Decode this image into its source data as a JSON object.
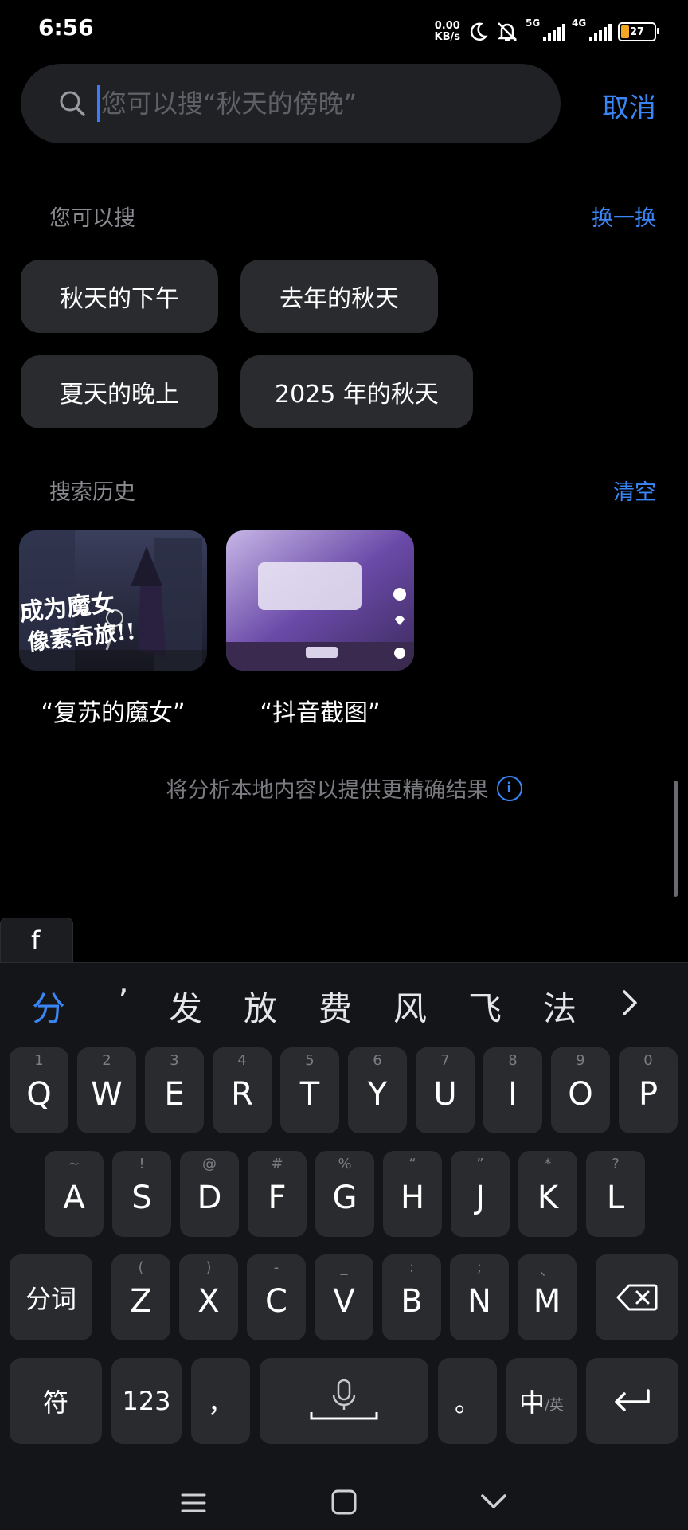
{
  "status": {
    "time": "6:56",
    "speed_top": "0.00",
    "speed_bottom": "KB/s",
    "net1": "5G",
    "net2": "4G",
    "battery": "27"
  },
  "search": {
    "placeholder": "您可以搜“秋天的傍晚”",
    "cancel": "取消"
  },
  "suggest": {
    "title": "您可以搜",
    "action": "换一换",
    "chips": [
      "秋天的下午",
      "去年的秋天",
      "夏天的晚上",
      "2025 年的秋天"
    ]
  },
  "history": {
    "title": "搜索历史",
    "action": "清空",
    "items": [
      {
        "caption": "“复苏的魔女”",
        "overlay_line1": "成为魔女",
        "overlay_line2": "像素奇旅!!"
      },
      {
        "caption": "“抖音截图”"
      }
    ]
  },
  "note": {
    "text": "将分析本地内容以提供更精确结果",
    "icon": "info-icon"
  },
  "keyboard": {
    "composing": "f",
    "candidates": [
      "分",
      "’",
      "发",
      "放",
      "费",
      "风",
      "飞",
      "法"
    ],
    "more_icon": "chevron-right-icon",
    "row1": [
      {
        "k": "Q",
        "h": "1"
      },
      {
        "k": "W",
        "h": "2"
      },
      {
        "k": "E",
        "h": "3"
      },
      {
        "k": "R",
        "h": "4"
      },
      {
        "k": "T",
        "h": "5"
      },
      {
        "k": "Y",
        "h": "6"
      },
      {
        "k": "U",
        "h": "7"
      },
      {
        "k": "I",
        "h": "8"
      },
      {
        "k": "O",
        "h": "9"
      },
      {
        "k": "P",
        "h": "0"
      }
    ],
    "row2": [
      {
        "k": "A",
        "h": "~"
      },
      {
        "k": "S",
        "h": "!"
      },
      {
        "k": "D",
        "h": "@"
      },
      {
        "k": "F",
        "h": "#"
      },
      {
        "k": "G",
        "h": "%"
      },
      {
        "k": "H",
        "h": "“"
      },
      {
        "k": "J",
        "h": "”"
      },
      {
        "k": "K",
        "h": "*"
      },
      {
        "k": "L",
        "h": "?"
      }
    ],
    "row3": [
      {
        "k": "Z",
        "h": "("
      },
      {
        "k": "X",
        "h": ")"
      },
      {
        "k": "C",
        "h": "-"
      },
      {
        "k": "V",
        "h": "_"
      },
      {
        "k": "B",
        "h": ":"
      },
      {
        "k": "N",
        "h": ";"
      },
      {
        "k": "M",
        "h": "、"
      }
    ],
    "fenci": "分词",
    "symbols": "符",
    "numbers": "123",
    "comma": "，",
    "period": "。",
    "lang_main": "中",
    "lang_sub": "/英"
  }
}
